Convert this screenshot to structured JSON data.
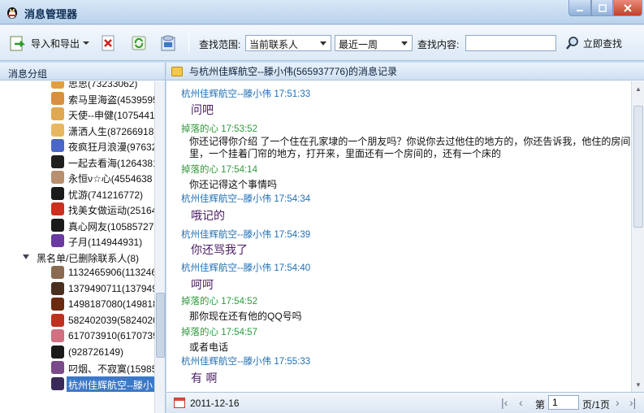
{
  "window": {
    "title": "消息管理器"
  },
  "toolbar": {
    "import_export": "导入和导出",
    "search_range_label": "查找范围:",
    "range_value": "当前联系人",
    "period_value": "最近一周",
    "search_content_label": "查找内容:",
    "search_placeholder": "",
    "search_button": "立即查找"
  },
  "left": {
    "header": "消息分组",
    "contacts": [
      {
        "name": "思思(73233062)",
        "color": "#e0a040"
      },
      {
        "name": "索马里海盗(4539595",
        "color": "#d89040"
      },
      {
        "name": "天使--申健(1075441",
        "color": "#e0a850"
      },
      {
        "name": "潇洒人生(87266918)",
        "color": "#e8b860"
      },
      {
        "name": "夜疯狂月浪漫(97632",
        "color": "#4a66c8"
      },
      {
        "name": "一起去看海(1264381",
        "color": "#202020"
      },
      {
        "name": "永恒ν☆心(4554638",
        "color": "#b89070"
      },
      {
        "name": "忧游(741216772)",
        "color": "#1a1a1a"
      },
      {
        "name": "找美女做运动(25164",
        "color": "#cc3020"
      },
      {
        "name": "真心网友(105857278",
        "color": "#1a1a1a"
      },
      {
        "name": "子月(114944931)",
        "color": "#6a3aa0"
      }
    ],
    "group_label": "黑名单/已删除联系人(8)",
    "blacklist": [
      {
        "name": "1132465906(1132465",
        "color": "#8a6a50"
      },
      {
        "name": "1379490711(1379490",
        "color": "#4a3020"
      },
      {
        "name": "1498187080(1498187",
        "color": "#6a2a10"
      },
      {
        "name": "582402039(58240203",
        "color": "#c03020"
      },
      {
        "name": "617073910(61707391",
        "color": "#d07080"
      },
      {
        "name": "(928726149)",
        "color": "#1a1a1a"
      },
      {
        "name": "叼烟、不寂寞(15985",
        "color": "#7a4a8a"
      },
      {
        "name": "杭州佳辉航空--滕小",
        "color": "#3a2a5a"
      }
    ]
  },
  "right": {
    "header": "与杭州佳辉航空--滕小伟(565937776)的消息记录",
    "messages": [
      {
        "kind": "hdr-b",
        "text": "杭州佳辉航空--滕小伟 17:51:33"
      },
      {
        "kind": "hand",
        "text": "问吧"
      },
      {
        "kind": "hdr-g",
        "text": "掉落的心 17:53:52"
      },
      {
        "kind": "body",
        "text": "你还记得你介绍 了一个住在孔家埭的一个朋友吗？你说你去过他住的地方的，你还告诉我，他住的房间里，一个挂着门帘的地方，打开来，里面还有一个房间的，还有一个床的"
      },
      {
        "kind": "hdr-g",
        "text": "掉落的心 17:54:14"
      },
      {
        "kind": "body",
        "text": "你还记得这个事情吗"
      },
      {
        "kind": "hdr-b",
        "text": "杭州佳辉航空--滕小伟 17:54:34"
      },
      {
        "kind": "hand",
        "text": "哦记的"
      },
      {
        "kind": "hdr-b",
        "text": "杭州佳辉航空--滕小伟 17:54:39"
      },
      {
        "kind": "hand",
        "text": "你还骂我了"
      },
      {
        "kind": "hdr-b",
        "text": "杭州佳辉航空--滕小伟 17:54:40"
      },
      {
        "kind": "hand",
        "text": "呵呵"
      },
      {
        "kind": "hdr-g",
        "text": "掉落的心 17:54:52"
      },
      {
        "kind": "body",
        "text": "那你现在还有他的QQ号吗"
      },
      {
        "kind": "hdr-g",
        "text": "掉落的心 17:54:57"
      },
      {
        "kind": "body",
        "text": "或者电话"
      },
      {
        "kind": "hdr-b",
        "text": "杭州佳辉航空--滕小伟 17:55:33"
      },
      {
        "kind": "hand",
        "text": "有 啊"
      }
    ]
  },
  "footer": {
    "date": "2011-12-16",
    "page_prefix": "第",
    "page_value": "1",
    "page_suffix": "页/1页"
  }
}
